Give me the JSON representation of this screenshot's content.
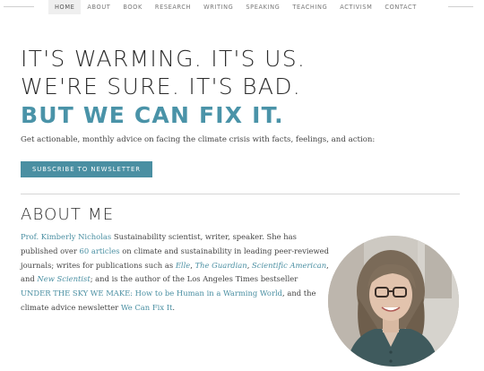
{
  "nav": {
    "items": [
      "HOME",
      "ABOUT",
      "BOOK",
      "RESEARCH",
      "WRITING",
      "SPEAKING",
      "TEACHING",
      "ACTIVISM",
      "CONTACT"
    ],
    "active": "HOME"
  },
  "hero": {
    "line1": "IT'S WARMING. IT'S US.",
    "line2": "WE'RE SURE. IT'S BAD.",
    "line3": "BUT WE CAN FIX IT.",
    "accent_color": "#4a93a8",
    "tagline": "Get actionable, monthly advice on facing the climate crisis with facts, feelings, and action:",
    "subscribe_label": "SUBSCRIBE TO NEWSLETTER"
  },
  "about": {
    "title": "ABOUT ME",
    "name_link": "Prof. Kimberly Nicholas",
    "t1": " Sustainability scientist, writer, speaker. She has published over ",
    "articles_link": "60 articles",
    "t2": " on climate and sustainability in leading peer-reviewed journals; writes for publications such as ",
    "elle_link": "Elle",
    "t3": ", ",
    "guardian_link": "The Guardian",
    "t4": ", ",
    "sciam_link": "Scientific American",
    "t5": ", and ",
    "newsci_link": "New Scientist",
    "t6": "; and is the author of the Los Angeles Times bestseller ",
    "book_link": "UNDER THE SKY WE MAKE: How to be Human in a Warming World",
    "t7": ", and the climate advice newsletter ",
    "newsletter_link": "We Can Fix It",
    "t8": "."
  }
}
